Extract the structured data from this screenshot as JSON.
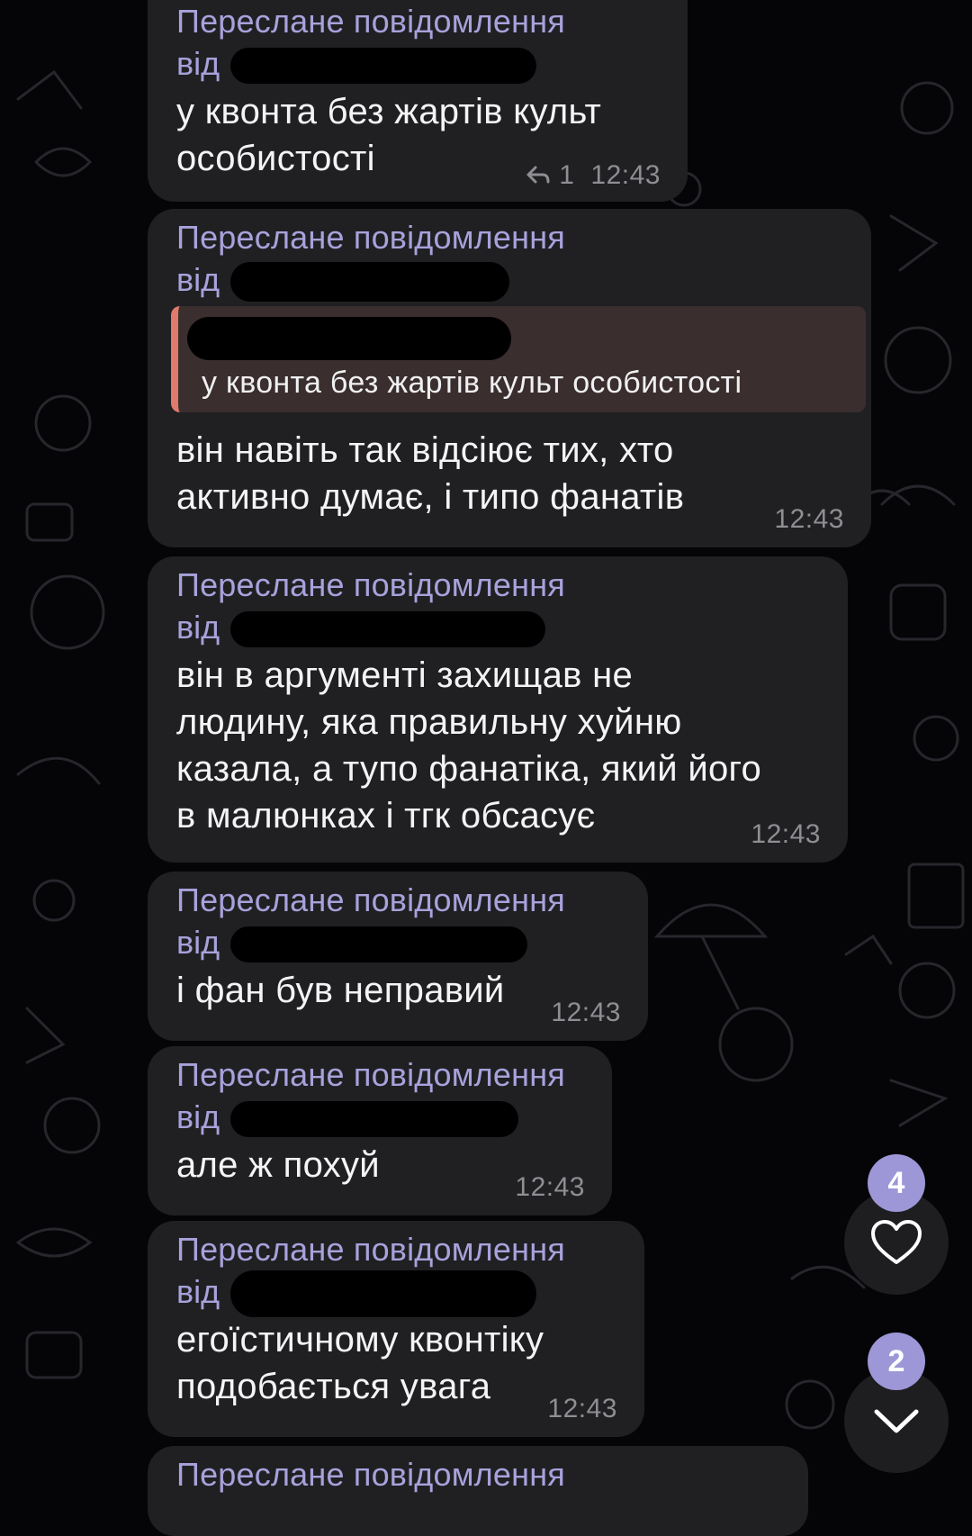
{
  "forwarded_label": "Переслане повідомлення",
  "from_label": "від",
  "messages": [
    {
      "text": "у квонта без жартів культ\nособистості",
      "replies": "1",
      "time": "12:43"
    },
    {
      "quote": "у квонта без жартів культ особистості",
      "text": "він навіть так відсіює тих, хто\nактивно думає, і типо фанатів",
      "time": "12:43"
    },
    {
      "text": "він в аргументі захищав не\nлюдину, яка правильну хуйню\nказала, а тупо фанатіка, який його\nв малюнках і тгк обсасує",
      "time": "12:43"
    },
    {
      "text": "і фан був неправий",
      "time": "12:43"
    },
    {
      "text": "але ж похуй",
      "time": "12:43"
    },
    {
      "text": "егоїстичному квонтіку\nподобається увага",
      "time": "12:43"
    }
  ],
  "reactions_badge": "4",
  "unread_badge": "2",
  "icons": {
    "reply": "reply-arrow-icon",
    "heart": "heart-icon",
    "down": "chevron-down-icon"
  },
  "colors": {
    "accent": "#a7a2db",
    "bubble": "#202023",
    "quote_border": "#e07a6a",
    "badge": "#9d97d8"
  }
}
